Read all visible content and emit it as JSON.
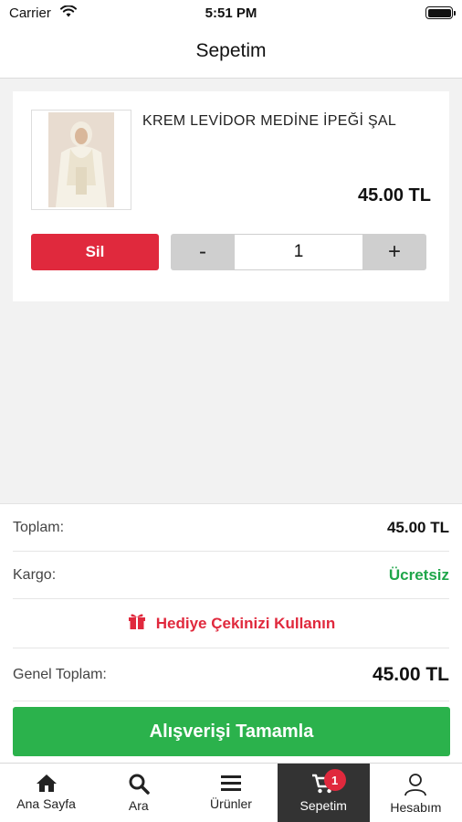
{
  "status_bar": {
    "carrier": "Carrier",
    "time": "5:51 PM"
  },
  "nav": {
    "title": "Sepetim"
  },
  "cart": {
    "items": [
      {
        "name": "KREM LEVİDOR MEDİNE İPEĞİ ŞAL",
        "price": "45.00 TL",
        "delete_label": "Sil",
        "quantity": "1",
        "decrement_label": "-",
        "increment_label": "+"
      }
    ]
  },
  "summary": {
    "total_label": "Toplam:",
    "total_value": "45.00 TL",
    "shipping_label": "Kargo:",
    "shipping_value": "Ücretsiz",
    "gift_label": "Hediye Çekinizi Kullanın",
    "grand_total_label": "Genel Toplam:",
    "grand_total_value": "45.00 TL",
    "checkout_label": "Alışverişi Tamamla"
  },
  "tabs": [
    {
      "label": "Ana Sayfa",
      "icon": "home-icon"
    },
    {
      "label": "Ara",
      "icon": "search-icon"
    },
    {
      "label": "Ürünler",
      "icon": "menu-icon"
    },
    {
      "label": "Sepetim",
      "icon": "cart-icon",
      "badge": "1",
      "active": true
    },
    {
      "label": "Hesabım",
      "icon": "user-icon"
    }
  ],
  "colors": {
    "accent_red": "#e0293d",
    "success_green": "#2bb24c",
    "active_tab": "#333333"
  }
}
